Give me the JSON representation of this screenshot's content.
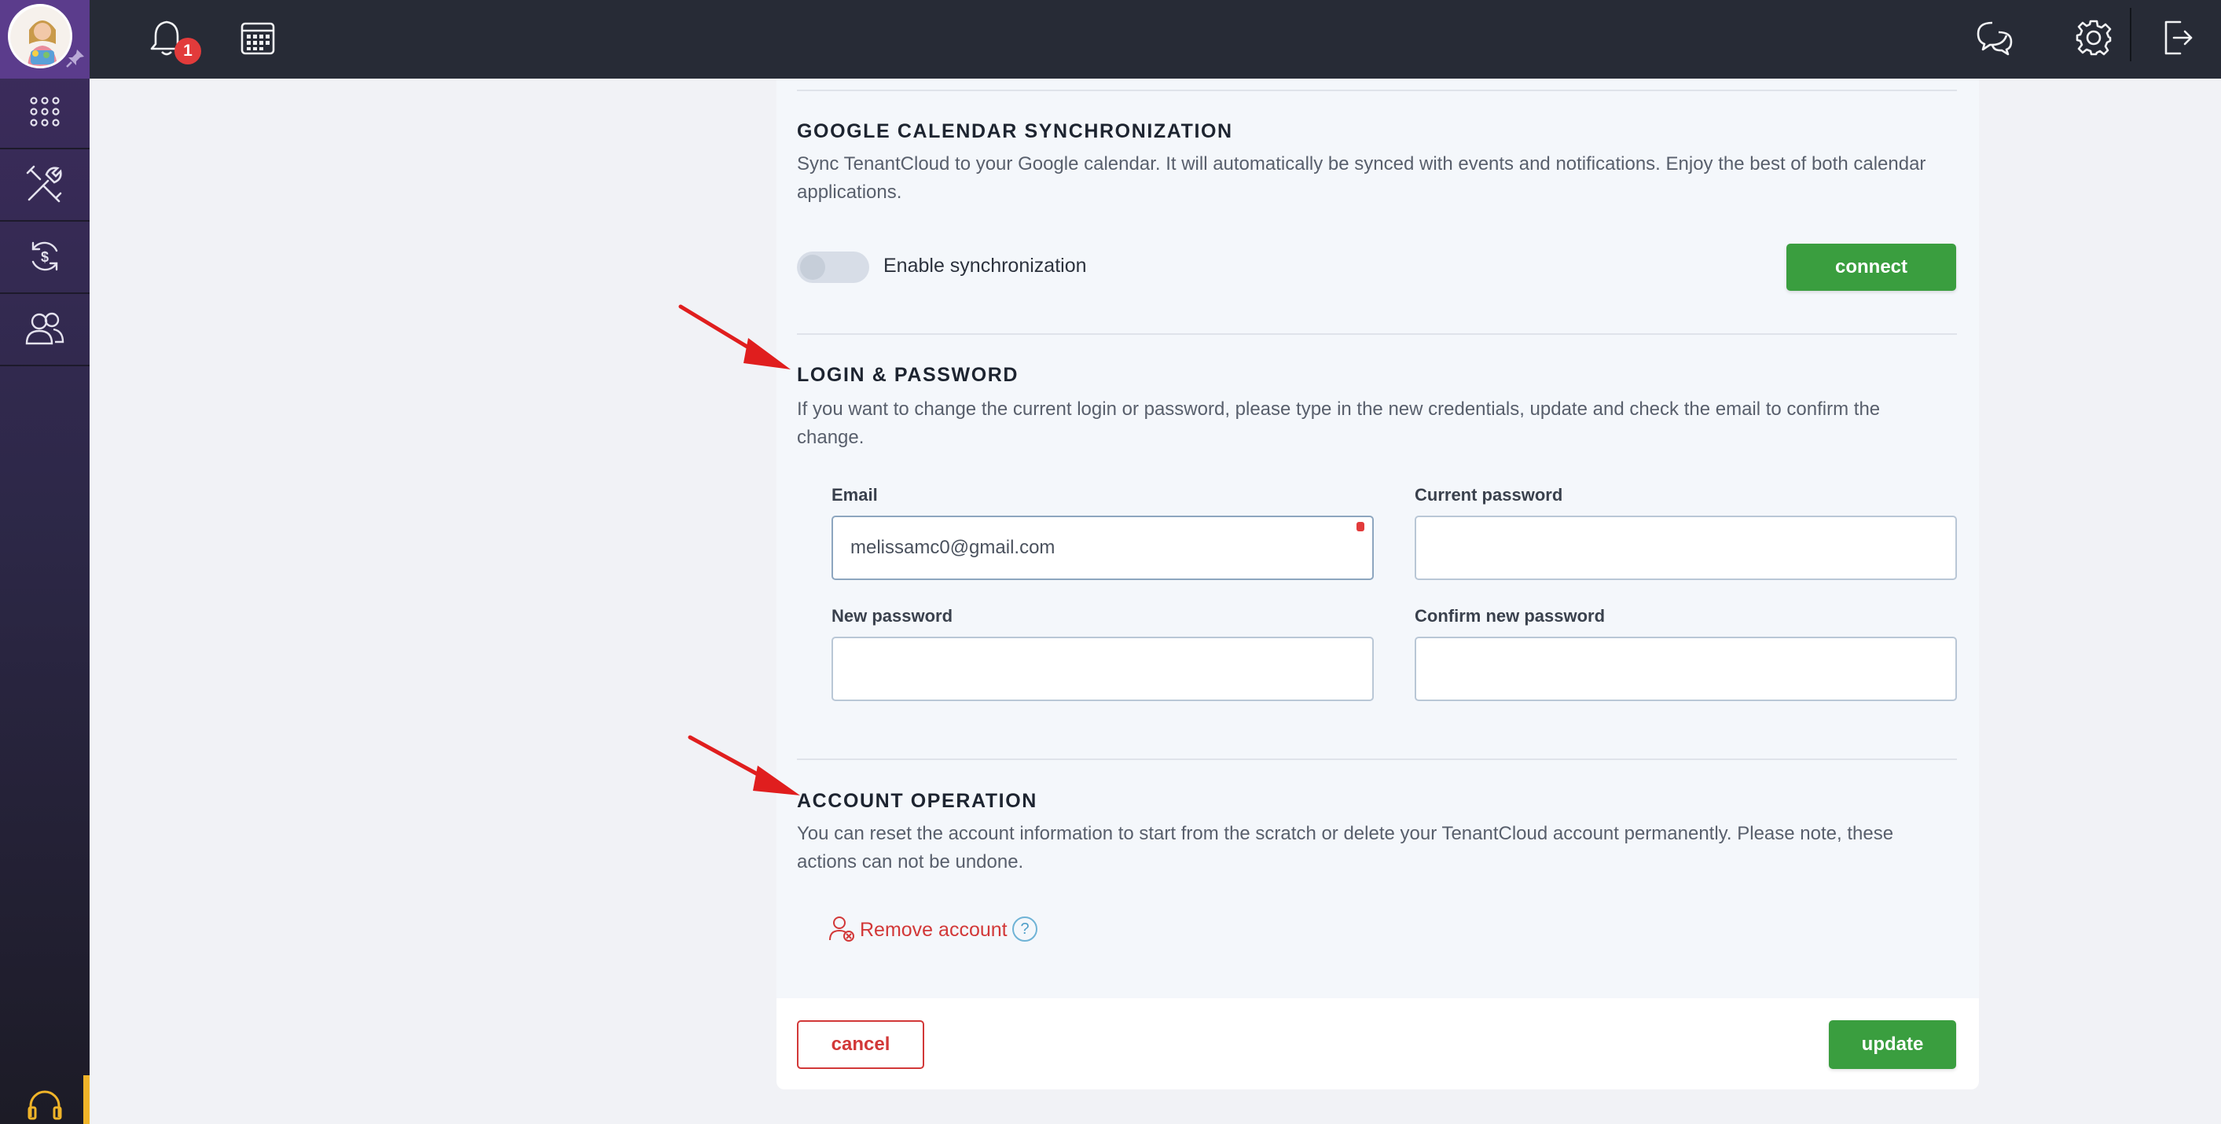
{
  "header": {
    "notification_count": "1",
    "icons": [
      "bell-icon",
      "calendar-icon",
      "chat-icon",
      "gear-icon",
      "logout-icon"
    ]
  },
  "sidebar": {
    "items": [
      {
        "icon": "apps-grid-icon"
      },
      {
        "icon": "tools-icon"
      },
      {
        "icon": "money-refresh-icon"
      },
      {
        "icon": "users-icon"
      }
    ],
    "help_icon": "headset-icon"
  },
  "sections": {
    "google_calendar": {
      "title": "GOOGLE CALENDAR SYNCHRONIZATION",
      "description": "Sync TenantCloud to your Google calendar. It will automatically be synced with events and notifications. Enjoy the best of both calendar applications.",
      "toggle_label": "Enable synchronization",
      "toggle_on": false,
      "connect_label": "connect"
    },
    "login_password": {
      "title": "LOGIN & PASSWORD",
      "description": "If you want to change the current login or password, please type in the new credentials, update and check the email to confirm the change.",
      "email_label": "Email",
      "email_value": "melissamc0@gmail.com",
      "current_password_label": "Current password",
      "new_password_label": "New password",
      "confirm_password_label": "Confirm new password"
    },
    "account_operation": {
      "title": "ACCOUNT OPERATION",
      "description": "You can reset the account information to start from the scratch or delete your TenantCloud account permanently. Please note, these actions can not be undone.",
      "remove_label": "Remove account",
      "help_label": "?"
    }
  },
  "footer": {
    "cancel_label": "cancel",
    "update_label": "update"
  },
  "colors": {
    "accent_green": "#3a9e3f",
    "danger_red": "#d23838",
    "topbar": "#272b36",
    "sidebar": "#2d2848"
  }
}
